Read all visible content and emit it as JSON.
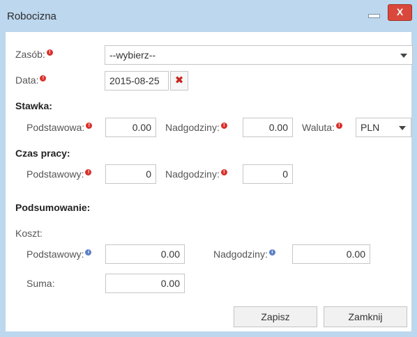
{
  "window": {
    "title": "Robocizna",
    "close_glyph": "X"
  },
  "form": {
    "resource": {
      "label": "Zasób:",
      "selected": "--wybierz--"
    },
    "date": {
      "label": "Data:",
      "value": "2015-08-25"
    },
    "rate": {
      "heading": "Stawka:",
      "basic_label": "Podstawowa:",
      "basic_value": "0.00",
      "overtime_label": "Nadgodziny:",
      "overtime_value": "0.00",
      "currency_label": "Waluta:",
      "currency_selected": "PLN"
    },
    "worktime": {
      "heading": "Czas pracy:",
      "basic_label": "Podstawowy:",
      "basic_value": "0",
      "overtime_label": "Nadgodziny:",
      "overtime_value": "0"
    },
    "summary": {
      "heading": "Podsumowanie:",
      "cost_label": "Koszt:",
      "basic_label": "Podstawowy:",
      "basic_value": "0.00",
      "overtime_label": "Nadgodziny:",
      "overtime_value": "0.00",
      "total_label": "Suma:",
      "total_value": "0.00"
    }
  },
  "buttons": {
    "save": "Zapisz",
    "close": "Zamknij"
  },
  "colors": {
    "required": "#d9302a",
    "info": "#5b7fc7",
    "titlebar": "#bcd7ee",
    "close": "#d9483b"
  }
}
